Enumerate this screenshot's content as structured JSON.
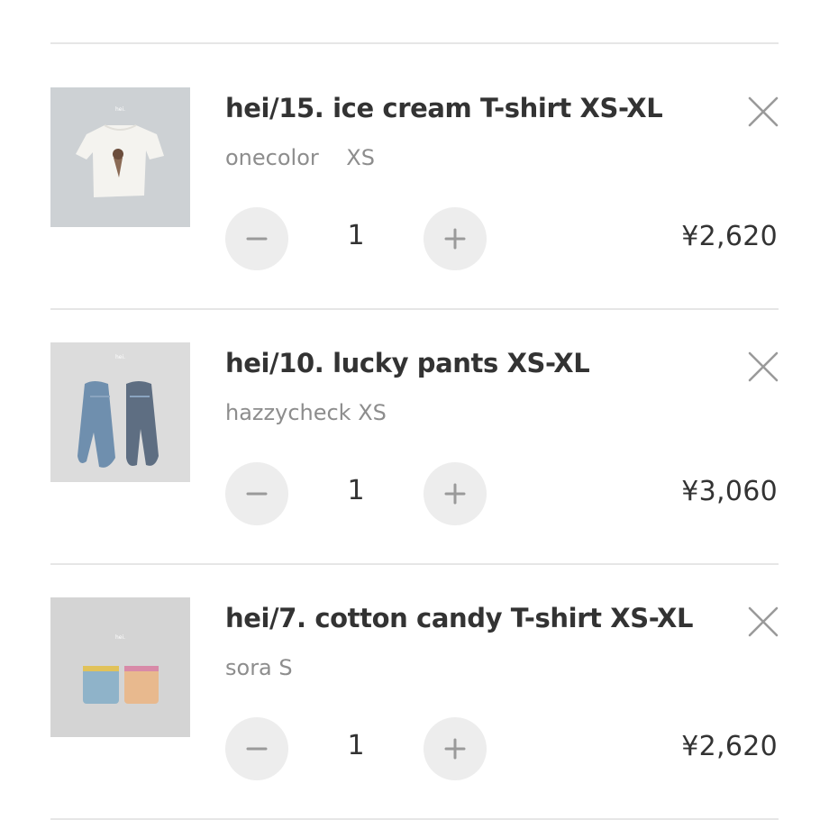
{
  "cart": {
    "items": [
      {
        "title": "hei/15. ice cream T-shirt XS-XL",
        "variant": "onecolor    XS",
        "quantity": "1",
        "price": "¥2,620",
        "image_icon": "tshirt-photo",
        "remove_icon": "close-icon",
        "minus_icon": "minus-icon",
        "plus_icon": "plus-icon"
      },
      {
        "title": "hei/10. lucky pants XS-XL",
        "variant": "hazzycheck XS",
        "quantity": "1",
        "price": "¥3,060",
        "image_icon": "pants-photo",
        "remove_icon": "close-icon",
        "minus_icon": "minus-icon",
        "plus_icon": "plus-icon"
      },
      {
        "title": "hei/7. cotton candy T-shirt XS-XL",
        "variant": "sora S",
        "quantity": "1",
        "price": "¥2,620",
        "image_icon": "tshirts-photo",
        "remove_icon": "close-icon",
        "minus_icon": "minus-icon",
        "plus_icon": "plus-icon"
      }
    ]
  },
  "colors": {
    "divider": "#e6e6e6",
    "button_bg": "#ededed",
    "title_text": "#333333",
    "variant_text": "#8d8d8d",
    "icon_stroke": "#9a9a9a"
  }
}
